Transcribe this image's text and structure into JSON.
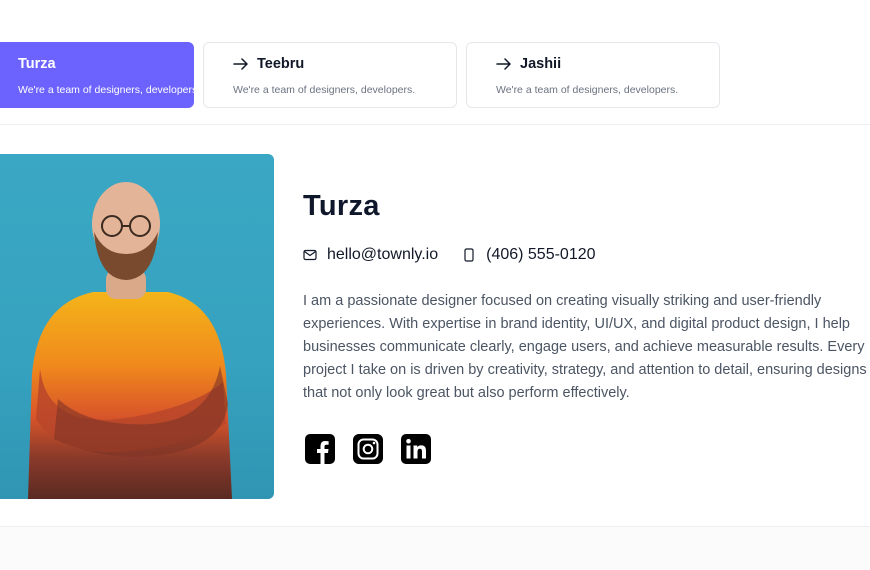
{
  "tabs": [
    {
      "title": "Turza",
      "desc": "We're a team of designers, developers."
    },
    {
      "title": "Teebru",
      "desc": "We're a team of designers, developers."
    },
    {
      "title": "Jashii",
      "desc": "We're a team of designers, developers."
    }
  ],
  "profile": {
    "name": "Turza",
    "email": "hello@townly.io",
    "phone": "(406) 555-0120",
    "bio_lines": [
      "I am a passionate designer focused on creating visually striking and user-friendly",
      "experiences. With expertise in brand identity, UI/UX, and digital product design, I help",
      "businesses communicate clearly, engage users, and achieve measurable results. Every",
      "project I take on is driven by creativity, strategy, and attention to detail, ensuring designs",
      "that not only look great but also perform effectively."
    ],
    "social": [
      "facebook-icon",
      "instagram-icon",
      "linkedin-icon"
    ]
  },
  "colors": {
    "accent": "#6c63ff",
    "photo_bg": "#36a2bf"
  }
}
